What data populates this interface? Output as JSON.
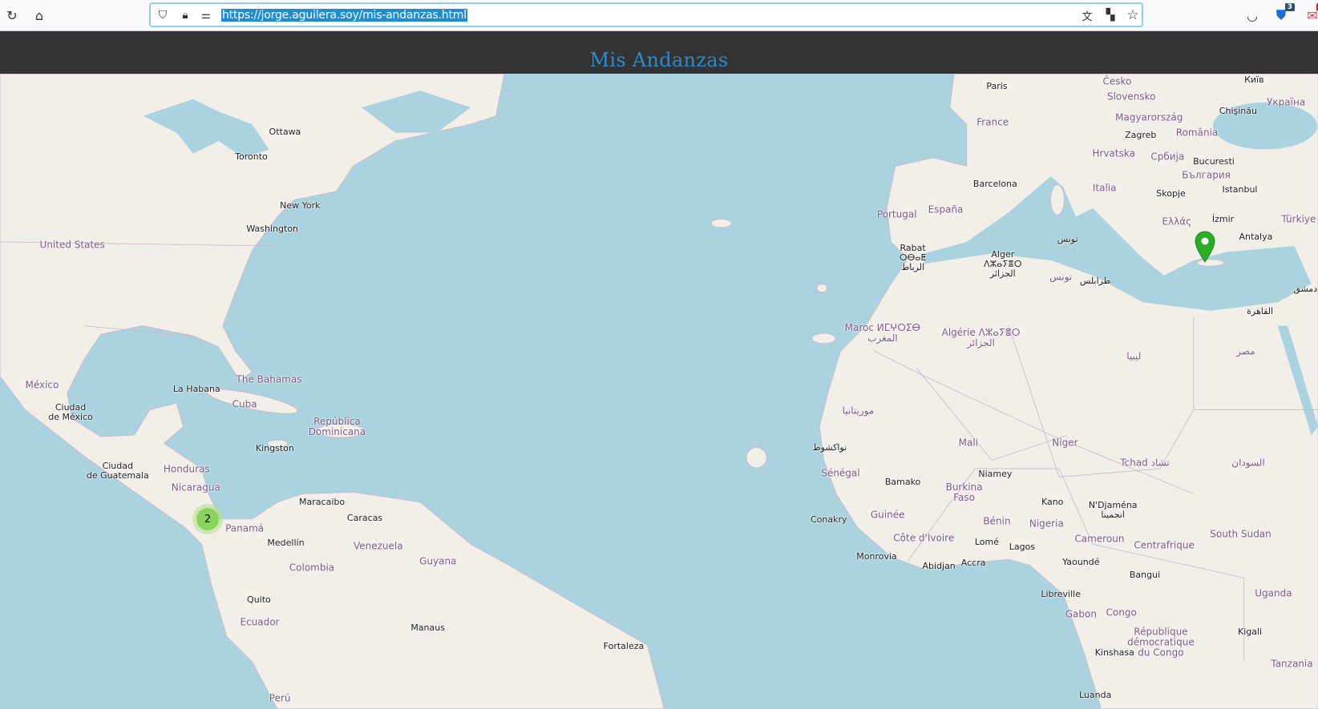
{
  "browser": {
    "url": "https://jorge.aguilera.soy/mis-andanzas.html",
    "extension_badges": [
      "3",
      "1"
    ]
  },
  "header": {
    "title": "Mis Andanzas"
  },
  "map": {
    "colors": {
      "water": "#aad3df",
      "land": "#f2efe9",
      "cluster": "#6ecc39",
      "marker": "#2aad27"
    },
    "cluster": {
      "count": "2"
    },
    "marker": {
      "icon": "map-pin-icon"
    },
    "cities": [
      "Paris",
      "Ottawa",
      "Toronto",
      "New York",
      "Washington",
      "La Habana",
      "Kingston",
      "Ciudad\nde México",
      "Ciudad\nde Guatemala",
      "Maracaibo",
      "Caracas",
      "Medellín",
      "Quito",
      "Manaus",
      "Fortaleza",
      "Barcelona",
      "Rabat\nⵔⴱⴰⵟ\nالرباط",
      "Alger\nⴷⵣⴰⵢⴻⵔ\nالجزائر",
      "Zagreb",
      "Bucuresti",
      "Skopje",
      "Istanbul",
      "İzmir",
      "Antalya",
      "Київ",
      "Chişinău",
      "Bamako",
      "Niamey",
      "Conakry",
      "Monrovia",
      "Abidjan",
      "Accra",
      "Lomé",
      "Lagos",
      "Kano",
      "N'Djaména\nانجمينا",
      "Yaoundé",
      "Bangui",
      "Libreville",
      "Kinshasa",
      "Luanda",
      "Kigali",
      "نواكشوط",
      "القاهرة",
      "تونس",
      "طرابلس",
      "دمشق"
    ],
    "countries": [
      "United States",
      "México",
      "The Bahamas",
      "Cuba",
      "República\nDominicana",
      "Honduras",
      "Nicaragua",
      "Panamá",
      "Venezuela",
      "Colombia",
      "Guyana",
      "Ecuador",
      "Perú",
      "France",
      "Portugal",
      "España",
      "Italia",
      "Hrvatska",
      "Србија",
      "România",
      "България",
      "Magyarország",
      "Slovensko",
      "Česko",
      "Україна",
      "Ελλάς",
      "Türkiye",
      "Maroc ⵍⵎⵖⵔⵉⴱ\nالمغرب",
      "Algérie ⴷⵣⴰⵢⴻⵔ\nالجزائر",
      "تونس",
      "ليبيا",
      "مصر",
      "موريتانيا",
      "Mali",
      "Niger",
      "Tchad تشاد",
      "السودان",
      "Sénégal",
      "Guinée",
      "Burkina\nFaso",
      "Bénin",
      "Nigeria",
      "Côte d'Ivoire",
      "Cameroun",
      "Centrafrique",
      "South Sudan",
      "Gabon",
      "Congo",
      "République\ndémocratique\ndu Congo",
      "Uganda",
      "Tanzania"
    ]
  }
}
